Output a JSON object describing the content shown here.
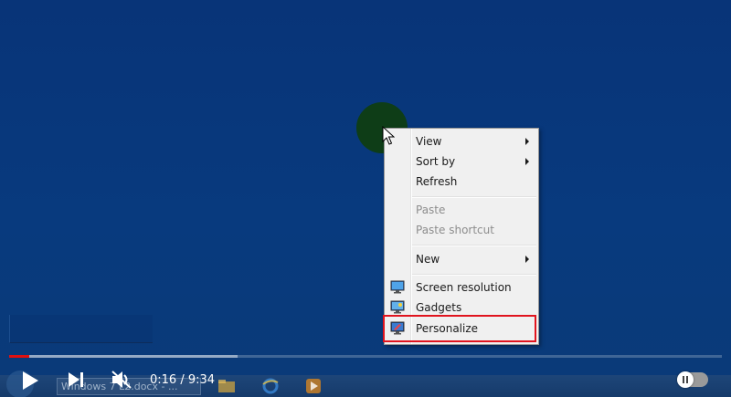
{
  "context_menu": {
    "items": [
      {
        "label": "View",
        "submenu": true,
        "disabled": false
      },
      {
        "label": "Sort by",
        "submenu": true,
        "disabled": false
      },
      {
        "label": "Refresh",
        "submenu": false,
        "disabled": false
      },
      {
        "label": "Paste",
        "submenu": false,
        "disabled": true
      },
      {
        "label": "Paste shortcut",
        "submenu": false,
        "disabled": true
      },
      {
        "label": "New",
        "submenu": true,
        "disabled": false
      },
      {
        "label": "Screen resolution",
        "submenu": false,
        "disabled": false,
        "icon": "monitor-icon"
      },
      {
        "label": "Gadgets",
        "submenu": false,
        "disabled": false,
        "icon": "gadgets-icon"
      },
      {
        "label": "Personalize",
        "submenu": false,
        "disabled": false,
        "icon": "personalize-icon",
        "highlighted": true
      }
    ]
  },
  "player": {
    "time_display": "0:16 / 9:34",
    "progress_fraction": 0.028,
    "buffered_fraction": 0.32,
    "colors": {
      "played": "#e01010",
      "highlight_box": "#e0141e"
    }
  },
  "taskbar_ghost": {
    "doc_button_label": "Windows 7 L2.docx - ..."
  }
}
